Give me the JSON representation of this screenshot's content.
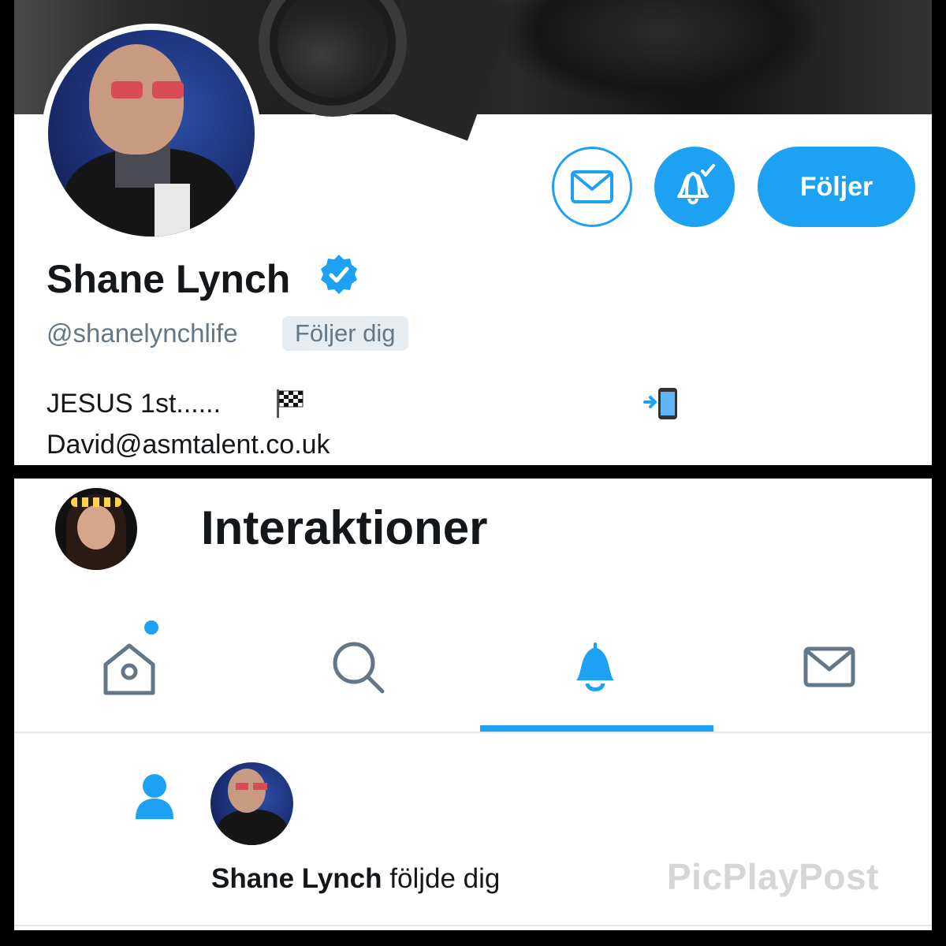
{
  "profile": {
    "name": "Shane Lynch",
    "handle": "@shanelynchlife",
    "follows_you_badge": "Följer dig",
    "follow_button": "Följer",
    "bio_line1": "JESUS 1st......",
    "bio_line2": "David@asmtalent.co.uk",
    "icons": [
      "mail-icon",
      "bell-check-icon",
      "verified-badge-icon",
      "checkered-flag-icon",
      "phone-arrow-icon"
    ]
  },
  "notifications": {
    "title": "Interaktioner",
    "tabs": [
      "home",
      "search",
      "notifications",
      "messages"
    ],
    "active_tab": "notifications",
    "item": {
      "name": "Shane Lynch",
      "action": " följde dig"
    }
  },
  "watermark": "PicPlayPost",
  "colors": {
    "accent": "#1da1f2",
    "text": "#14171a",
    "muted": "#657786",
    "badge_bg": "#e6ecf0"
  }
}
